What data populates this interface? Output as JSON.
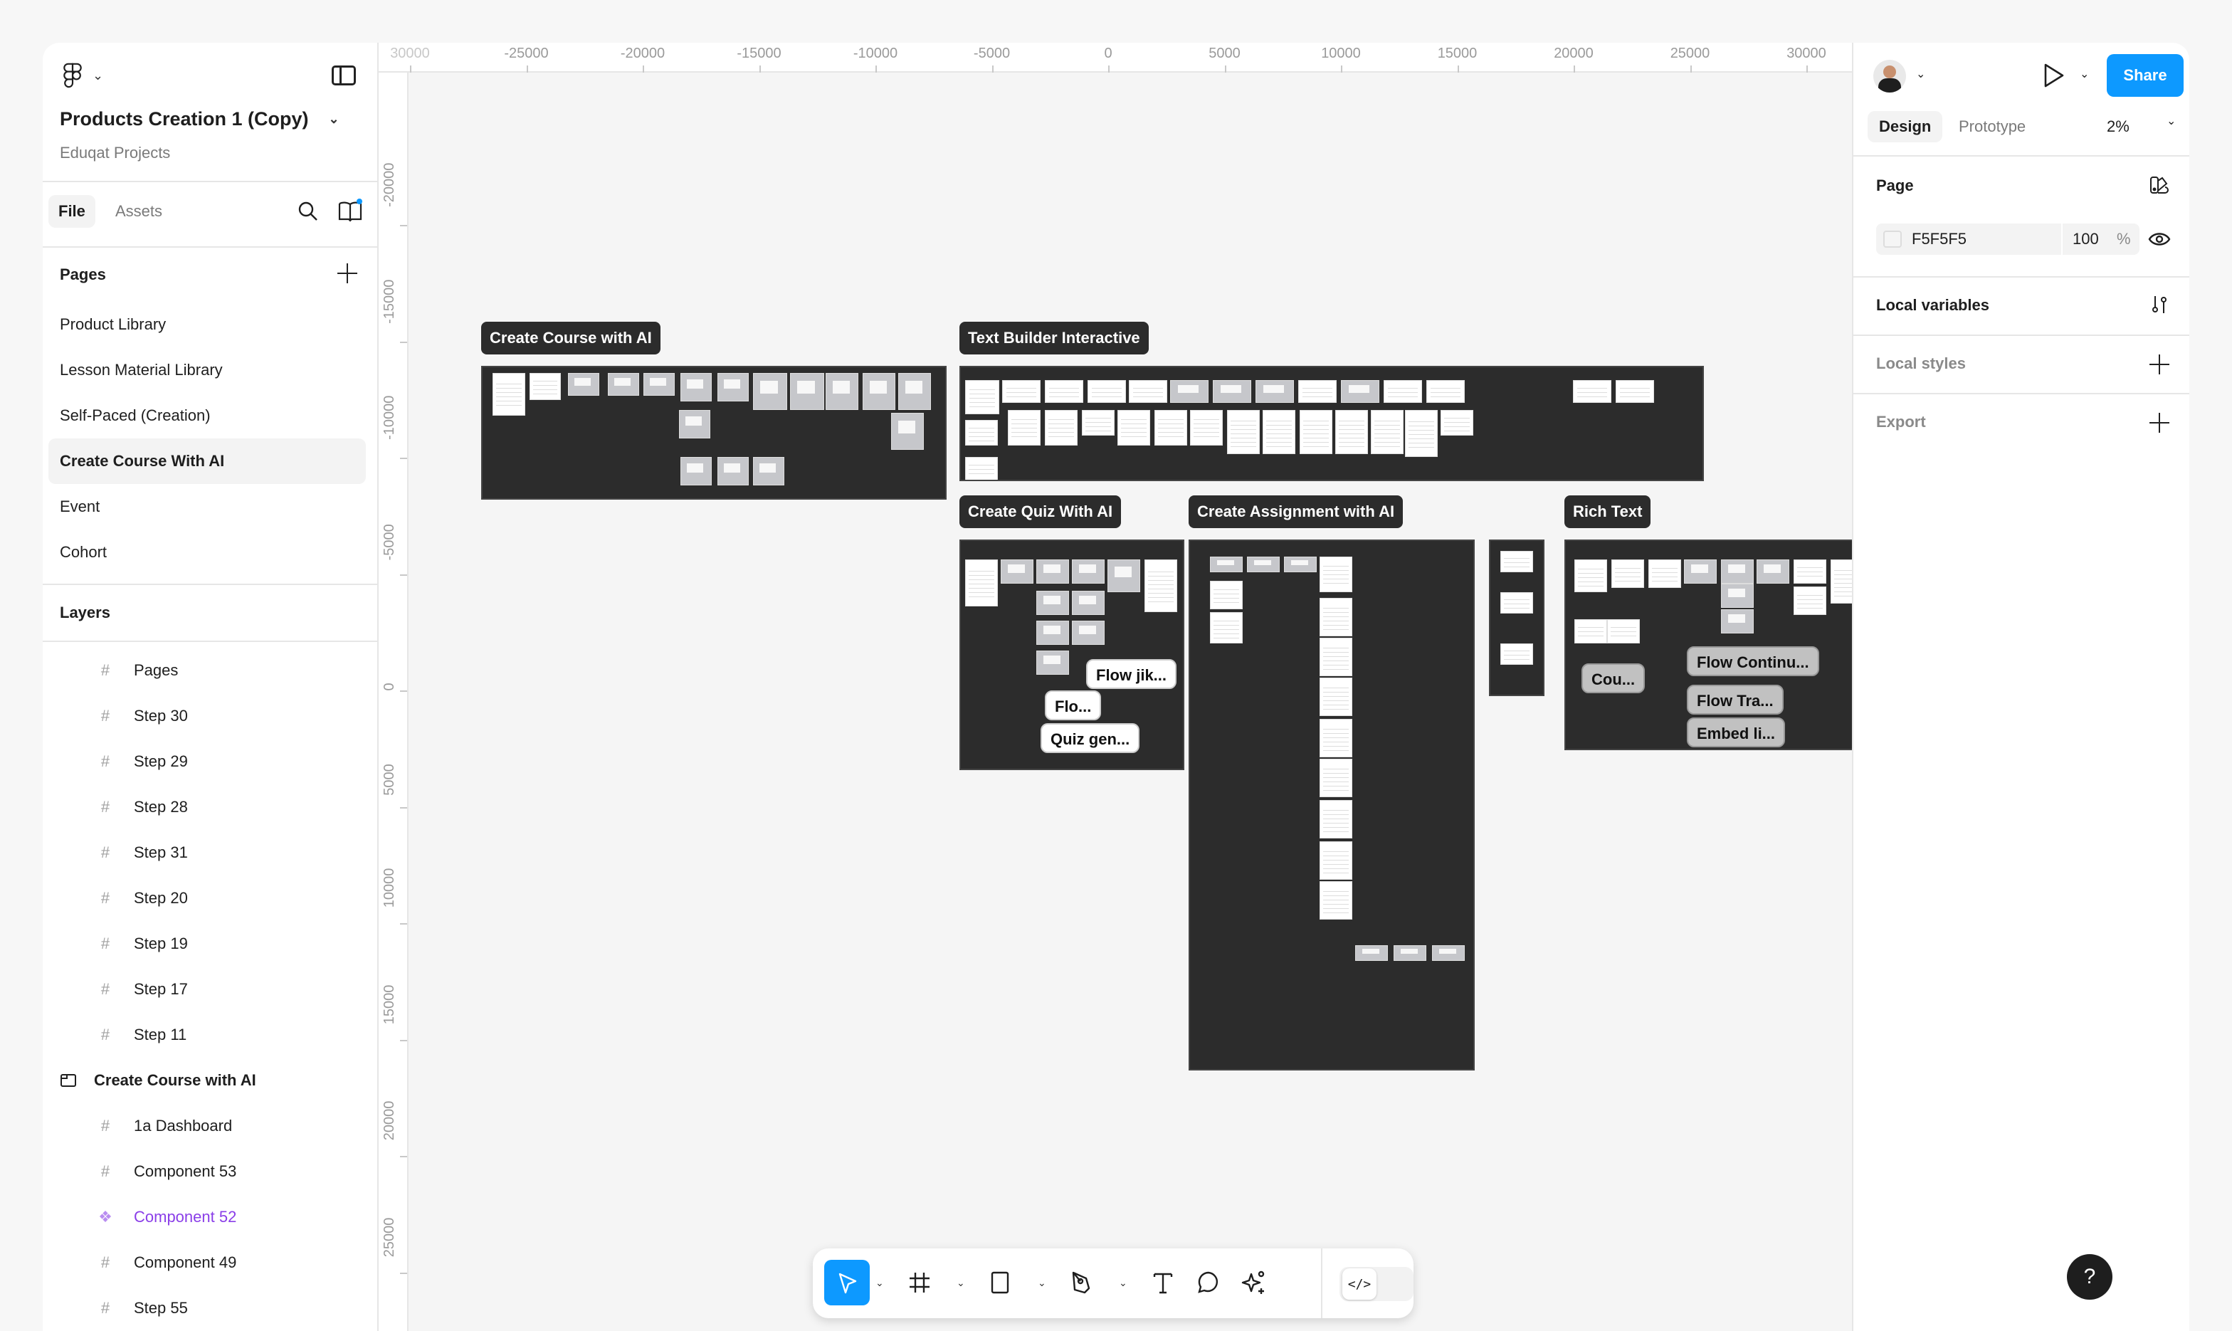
{
  "file": {
    "title": "Products Creation 1 (Copy)",
    "project": "Eduqat Projects"
  },
  "left_tabs": {
    "file": "File",
    "assets": "Assets"
  },
  "pages": {
    "heading": "Pages",
    "items": [
      {
        "label": "Product Library"
      },
      {
        "label": "Lesson Material Library"
      },
      {
        "label": "Self-Paced (Creation)"
      },
      {
        "label": "Create Course With AI",
        "selected": true
      },
      {
        "label": "Event"
      },
      {
        "label": "Cohort"
      }
    ]
  },
  "layers": {
    "heading": "Layers",
    "items": [
      {
        "label": "Pages",
        "type": "frame",
        "level": 2
      },
      {
        "label": "Step 30",
        "type": "frame",
        "level": 2
      },
      {
        "label": "Step 29",
        "type": "frame",
        "level": 2
      },
      {
        "label": "Step 28",
        "type": "frame",
        "level": 2
      },
      {
        "label": "Step 31",
        "type": "frame",
        "level": 2
      },
      {
        "label": "Step 20",
        "type": "frame",
        "level": 2
      },
      {
        "label": "Step 19",
        "type": "frame",
        "level": 2
      },
      {
        "label": "Step 17",
        "type": "frame",
        "level": 2
      },
      {
        "label": "Step 11",
        "type": "frame",
        "level": 2
      },
      {
        "label": "Create Course with AI",
        "type": "section",
        "level": 1
      },
      {
        "label": "1a Dashboard",
        "type": "frame",
        "level": 2
      },
      {
        "label": "Component 53",
        "type": "frame",
        "level": 2
      },
      {
        "label": "Component 52",
        "type": "component",
        "level": 2
      },
      {
        "label": "Component 49",
        "type": "frame",
        "level": 2
      },
      {
        "label": "Step 55",
        "type": "frame",
        "level": 2
      }
    ]
  },
  "rulers": {
    "horizontal": [
      "30000",
      "-25000",
      "-20000",
      "-15000",
      "-10000",
      "-5000",
      "0",
      "5000",
      "10000",
      "15000",
      "20000",
      "25000",
      "30000"
    ],
    "vertical": [
      "-20000",
      "-15000",
      "-10000",
      "-5000",
      "0",
      "5000",
      "10000",
      "15000",
      "20000",
      "25000"
    ]
  },
  "canvas": {
    "sections": [
      {
        "label": "Create Course with AI"
      },
      {
        "label": "Text Builder Interactive"
      },
      {
        "label": "Create Quiz With AI"
      },
      {
        "label": "Create Assignment with AI"
      },
      {
        "label": "Rich Text"
      }
    ],
    "stickies": {
      "quiz": [
        "Flow jik...",
        "Flo...",
        "Quiz gen..."
      ],
      "rich_text": [
        "Cou...",
        "Flow Continu...",
        "Flow Tra...",
        "Embed li..."
      ]
    }
  },
  "right_panel": {
    "share": "Share",
    "tabs": {
      "design": "Design",
      "prototype": "Prototype"
    },
    "zoom": "2%",
    "page": {
      "heading": "Page",
      "color_hex": "F5F5F5",
      "opacity": "100",
      "opacity_unit": "%"
    },
    "local_variables": "Local variables",
    "local_styles": "Local styles",
    "export": "Export"
  },
  "help": "?",
  "toolbar": {
    "tools": [
      "move-tool",
      "frame-tool",
      "rectangle-tool",
      "pen-tool",
      "text-tool",
      "comment-tool",
      "actions-tool"
    ],
    "dev_mode": "</>"
  },
  "colors": {
    "accent": "#0d99ff",
    "component": "#8a3ee8",
    "section_bg": "#2c2c2c",
    "canvas_bg": "#f5f5f5"
  }
}
